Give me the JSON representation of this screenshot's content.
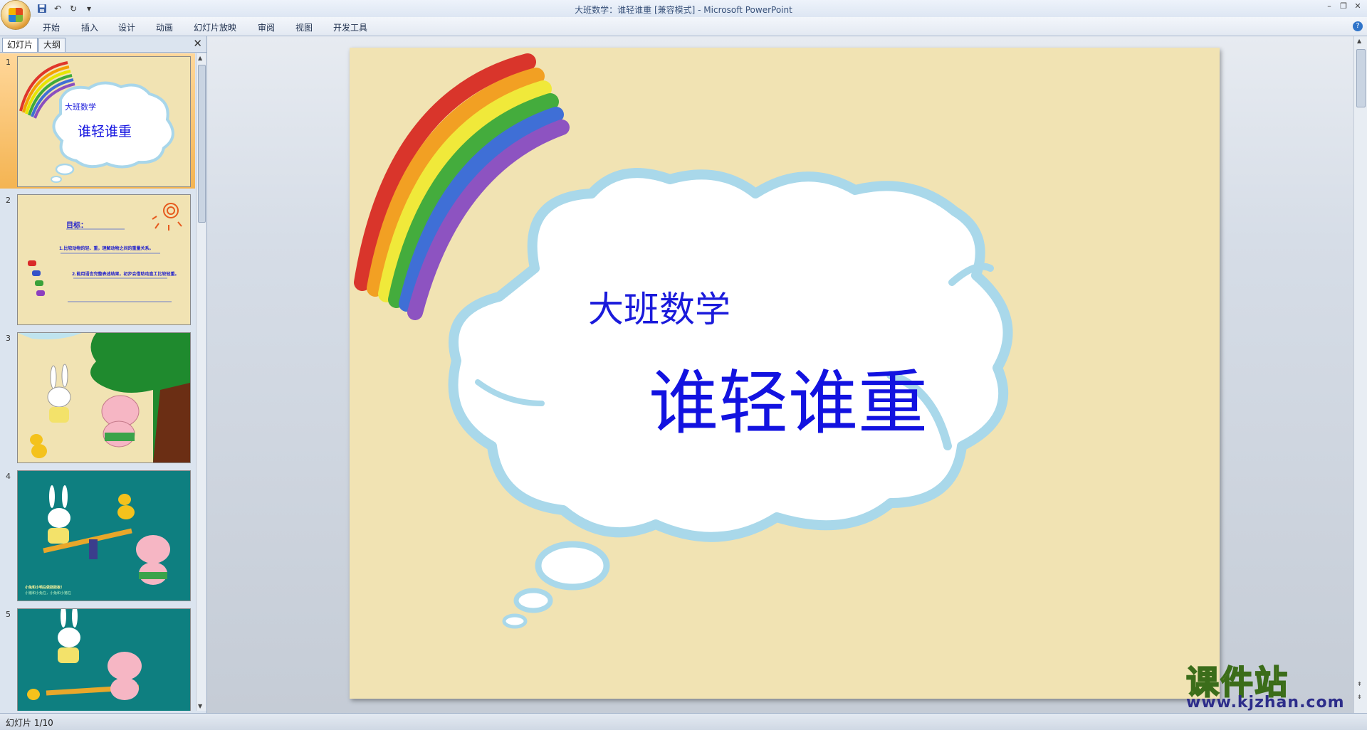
{
  "window": {
    "title": "大班数学：谁轻谁重 [兼容模式] - Microsoft PowerPoint"
  },
  "qat": {
    "save_icon": "save-icon",
    "undo_icon": "undo-icon",
    "redo_icon": "redo-icon"
  },
  "ribbon": {
    "tabs": [
      "开始",
      "插入",
      "设计",
      "动画",
      "幻灯片放映",
      "审阅",
      "视图",
      "开发工具"
    ]
  },
  "left_pane": {
    "tabs": [
      "幻灯片",
      "大纲"
    ],
    "selected_tab": "幻灯片",
    "thumbnails": [
      {
        "number": "1",
        "title": "大班数学",
        "subtitle": "谁轻谁重",
        "selected": true
      },
      {
        "number": "2",
        "heading": "目标：",
        "line1": "1.比较动物的轻、重，理解动物之间的重量关系。",
        "line2": "2.能用语言完整表述结果，初步会借助动直工比较轻重。"
      },
      {
        "number": "3"
      },
      {
        "number": "4",
        "caption1": "小兔和小鸭在做跷跷板！",
        "caption2": "小猪和小兔在，小兔和小猪在"
      },
      {
        "number": "5"
      }
    ]
  },
  "slide": {
    "subtitle": "大班数学",
    "title": "谁轻谁重"
  },
  "status": {
    "slide_indicator": "幻灯片 1/10"
  },
  "watermark": {
    "text": "课件站",
    "url": "www.kjzhan.com"
  },
  "colors": {
    "slide_bg": "#f1e3b3",
    "title_blue": "#1212e0",
    "selection": "#f4b452"
  }
}
